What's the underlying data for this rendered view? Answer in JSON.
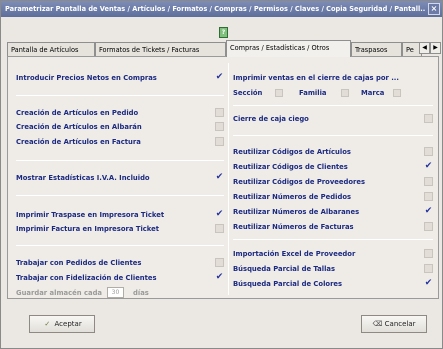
{
  "window": {
    "title": "Parametrizar Pantalla de Ventas / Artículos / Formatos / Compras / Permisos / Claves / Copia Seguridad / Pantall...",
    "close": "×"
  },
  "tabs": [
    {
      "label": "Pantalla de Artículos"
    },
    {
      "label": "Formatos de Tickets / Facturas"
    },
    {
      "label": "Compras / Estadísticas / Otros"
    },
    {
      "label": "Traspasos"
    },
    {
      "label": "Pe"
    }
  ],
  "tab_nav": {
    "left": "◀",
    "right": "▶"
  },
  "left": [
    {
      "label": "Introducir Precios Netos en Compras",
      "checked": true
    },
    {
      "label": "Creación de Artículos en Pedido",
      "checked": false
    },
    {
      "label": "Creación de Artículos en Albarán",
      "checked": false
    },
    {
      "label": "Creación de Artículos en Factura",
      "checked": false
    },
    {
      "label": "Mostrar Estadísticas I.V.A. Incluido",
      "checked": true
    },
    {
      "label": "Imprimir Traspase en Impresora Ticket",
      "checked": true
    },
    {
      "label": "Imprimir Factura en Impresora Ticket",
      "checked": false
    },
    {
      "label": "Trabajar con Pedidos de Clientes",
      "checked": false
    },
    {
      "label": "Trabajar con Fidelización de Clientes",
      "checked": true
    }
  ],
  "guardar": {
    "label": "Guardar almacén cada",
    "value": "30",
    "unit": "días"
  },
  "right": {
    "print_label": "Imprimir ventas en el cierre de cajas por ...",
    "sub": [
      {
        "label": "Sección",
        "checked": false
      },
      {
        "label": "Familia",
        "checked": false
      },
      {
        "label": "Marca",
        "checked": false
      }
    ],
    "items": [
      {
        "label": "Cierre de caja ciego",
        "checked": false
      },
      {
        "label": "Reutilizar Códigos de Artículos",
        "checked": false
      },
      {
        "label": "Reutilizar Códigos de Clientes",
        "checked": true
      },
      {
        "label": "Reutilizar Códigos de Proveedores",
        "checked": false
      },
      {
        "label": "Reutilizar Números de Pedidos",
        "checked": false
      },
      {
        "label": "Reutilizar Números de Albaranes",
        "checked": true
      },
      {
        "label": "Reutilizar Números de Facturas",
        "checked": false
      },
      {
        "label": "Importación Excel de Proveedor",
        "checked": false
      },
      {
        "label": "Búsqueda Parcial de Tallas",
        "checked": false
      },
      {
        "label": "Búsqueda Parcial de Colores",
        "checked": true
      }
    ]
  },
  "buttons": {
    "accept": "Aceptar",
    "cancel": "Cancelar"
  },
  "check_glyph": "✔"
}
